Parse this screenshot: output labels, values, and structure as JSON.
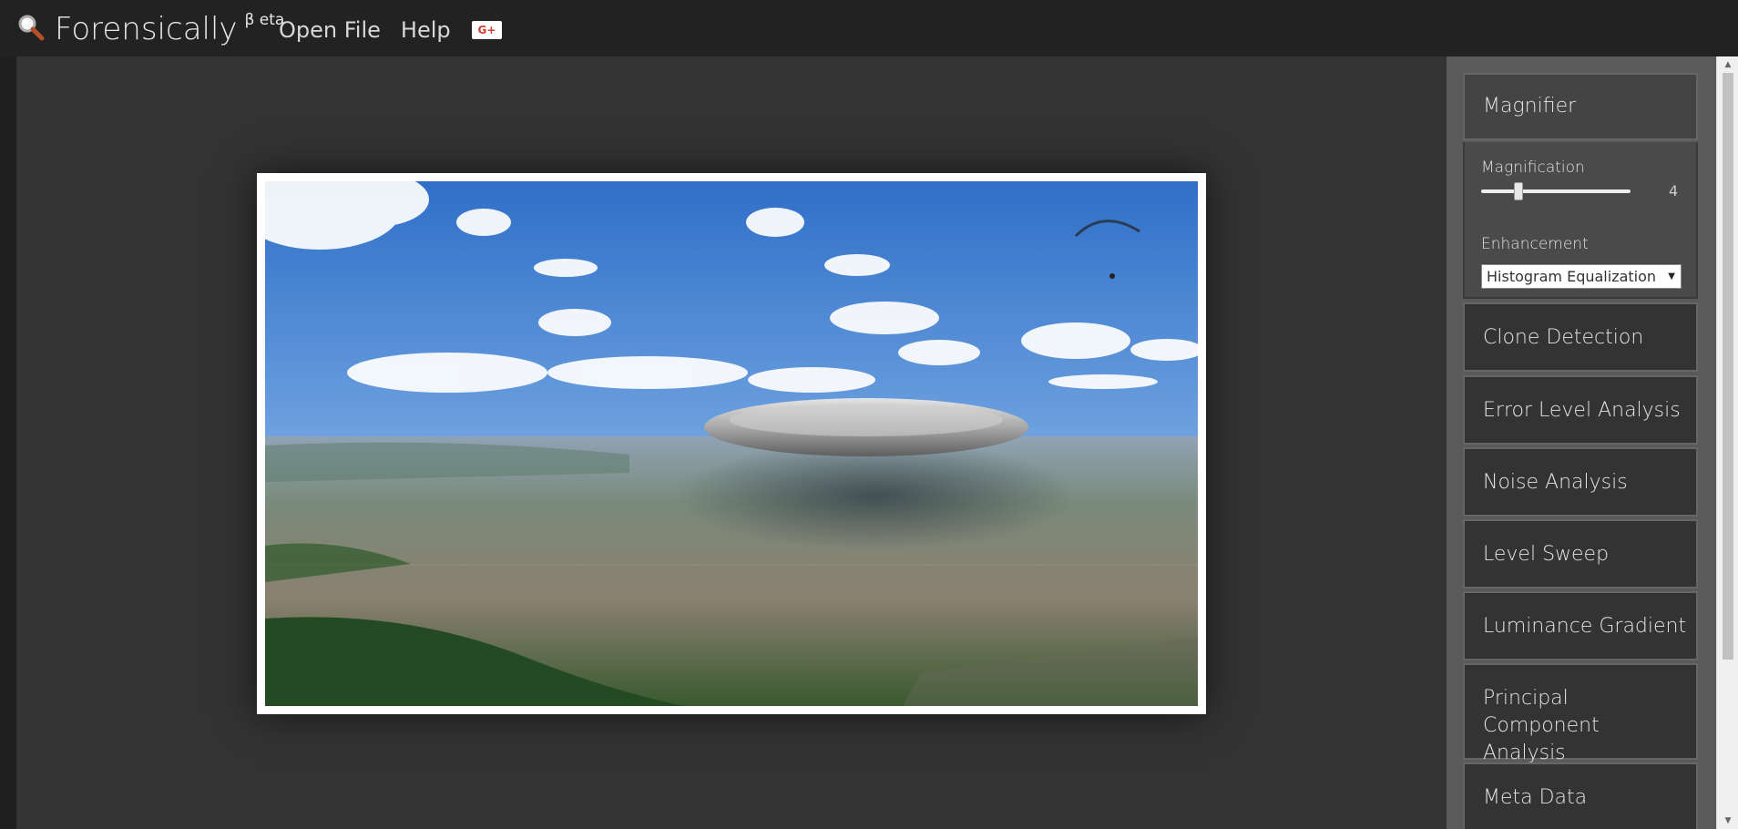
{
  "app": {
    "title": "Forensically",
    "superscript": "β eta"
  },
  "nav": {
    "open_file": "Open File",
    "help": "Help",
    "gplus_label": "G+"
  },
  "sidebar": {
    "magnifier": {
      "title": "Magnifier",
      "magnification_label": "Magnification",
      "magnification_value": "4",
      "enhancement_label": "Enhancement",
      "enhancement_value": "Histogram Equalization"
    },
    "tools": [
      {
        "label": "Clone Detection"
      },
      {
        "label": "Error Level Analysis"
      },
      {
        "label": "Noise Analysis"
      },
      {
        "label": "Level Sweep"
      },
      {
        "label": "Luminance Gradient"
      },
      {
        "label": "Principal Component Analysis"
      },
      {
        "label": "Meta Data"
      }
    ]
  },
  "colors": {
    "topbar": "#222222",
    "workspace": "#333333",
    "sidebar": "#5a5a5a",
    "panel": "#333333",
    "brand_accent": "#d23f31"
  }
}
